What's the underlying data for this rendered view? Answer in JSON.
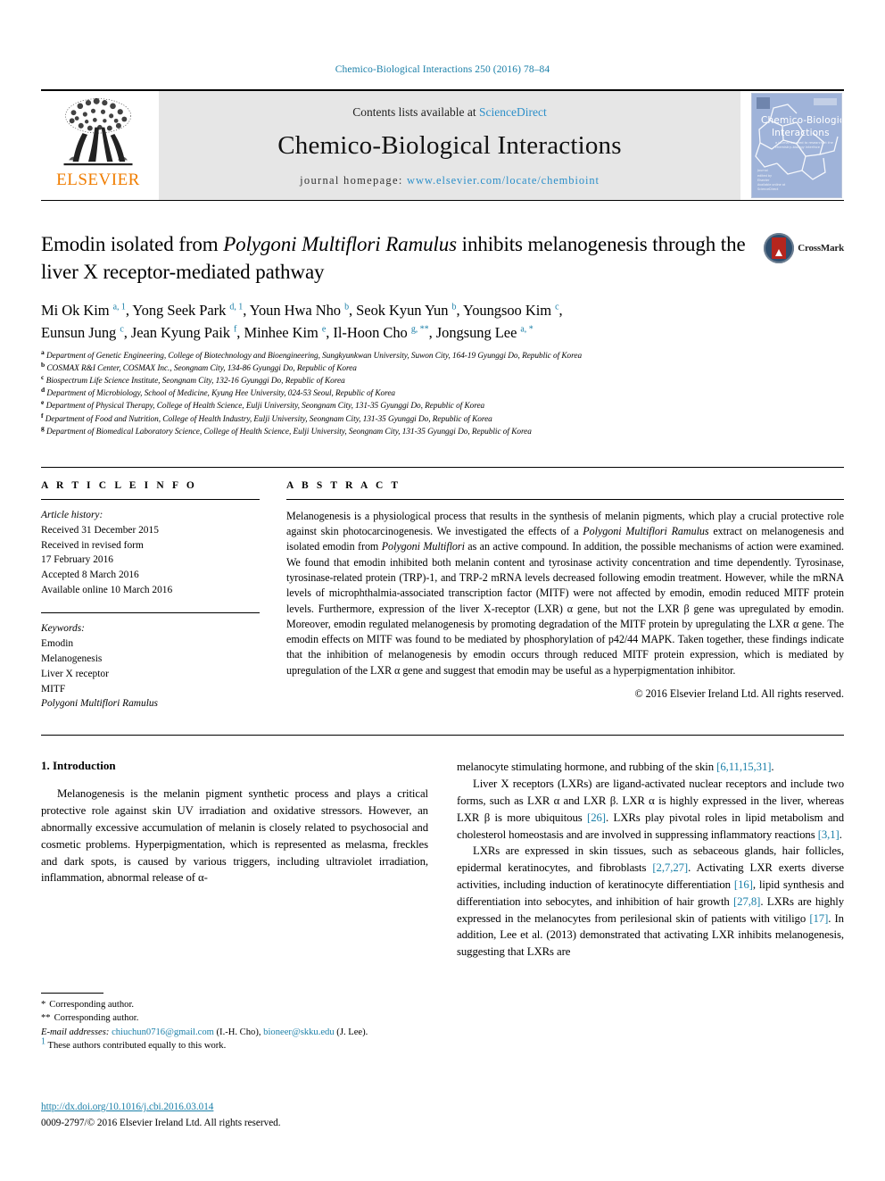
{
  "running_head": "Chemico-Biological Interactions 250 (2016) 78–84",
  "masthead": {
    "elsevier_wordmark": "ELSEVIER",
    "contents_prefix": "Contents lists available at ",
    "sciencedirect": "ScienceDirect",
    "journal_title": "Chemico-Biological Interactions",
    "homepage_prefix": "journal homepage: ",
    "homepage_url": "www.elsevier.com/locate/chembioint",
    "cover": {
      "line1": "Chemico-Biological",
      "line2": "Interactions",
      "subtitle": "a journal devoted to research at the chemistry–biology interface"
    }
  },
  "article": {
    "title_part1": "Emodin isolated from ",
    "title_italic": "Polygoni Multiflori Ramulus",
    "title_part2": " inhibits melanogenesis through the liver X receptor-mediated pathway",
    "crossmark_label": "CrossMark",
    "authors_line1": "Mi Ok Kim a, 1, Yong Seek Park d, 1, Youn Hwa Nho b, Seok Kyun Yun b, Youngsoo Kim c,",
    "authors_line2": "Eunsun Jung c, Jean Kyung Paik f, Minhee Kim e, Il-Hoon Cho g, **, Jongsung Lee a, *",
    "affiliations": [
      {
        "mark": "a",
        "text": "Department of Genetic Engineering, College of Biotechnology and Bioengineering, Sungkyunkwan University, Suwon City, 164-19 Gyunggi Do, Republic of Korea"
      },
      {
        "mark": "b",
        "text": "COSMAX R&I Center, COSMAX Inc., Seongnam City, 134-86 Gyunggi Do, Republic of Korea"
      },
      {
        "mark": "c",
        "text": "Biospectrum Life Science Institute, Seongnam City, 132-16 Gyunggi Do, Republic of Korea"
      },
      {
        "mark": "d",
        "text": "Department of Microbiology, School of Medicine, Kyung Hee University, 024-53 Seoul, Republic of Korea"
      },
      {
        "mark": "e",
        "text": "Department of Physical Therapy, College of Health Science, Eulji University, Seongnam City, 131-35 Gyunggi Do, Republic of Korea"
      },
      {
        "mark": "f",
        "text": "Department of Food and Nutrition, College of Health Industry, Eulji University, Seongnam City, 131-35 Gyunggi Do, Republic of Korea"
      },
      {
        "mark": "g",
        "text": "Department of Biomedical Laboratory Science, College of Health Science, Eulji University, Seongnam City, 131-35 Gyunggi Do, Republic of Korea"
      }
    ]
  },
  "article_info": {
    "label": "A R T I C L E   I N F O",
    "history_heading": "Article history:",
    "history": [
      "Received 31 December 2015",
      "Received in revised form",
      "17 February 2016",
      "Accepted 8 March 2016",
      "Available online 10 March 2016"
    ],
    "keywords_heading": "Keywords:",
    "keywords": [
      "Emodin",
      "Melanogenesis",
      "Liver X receptor",
      "MITF"
    ],
    "keyword_italic": "Polygoni Multiflori Ramulus"
  },
  "abstract": {
    "label": "A B S T R A C T",
    "p1": "Melanogenesis is a physiological process that results in the synthesis of melanin pigments, which play a crucial protective role against skin photocarcinogenesis. We investigated the effects of a ",
    "i1": "Polygoni Multiflori Ramulus",
    "p2": " extract on melanogenesis and isolated emodin from ",
    "i2": "Polygoni Multiflori",
    "p3": " as an active compound. In addition, the possible mechanisms of action were examined. We found that emodin inhibited both melanin content and tyrosinase activity concentration and time dependently. Tyrosinase, tyrosinase-related protein (TRP)-1, and TRP-2 mRNA levels decreased following emodin treatment. However, while the mRNA levels of microphthalmia-associated transcription factor (MITF) were not affected by emodin, emodin reduced MITF protein levels. Furthermore, expression of the liver X-receptor (LXR) α gene, but not the LXR β gene was upregulated by emodin. Moreover, emodin regulated melanogenesis by promoting degradation of the MITF protein by upregulating the LXR α gene. The emodin effects on MITF was found to be mediated by phosphorylation of p42/44 MAPK. Taken together, these findings indicate that the inhibition of melanogenesis by emodin occurs through reduced MITF protein expression, which is mediated by upregulation of the LXR α gene and suggest that emodin may be useful as a hyperpigmentation inhibitor.",
    "copyright": "© 2016 Elsevier Ireland Ltd. All rights reserved."
  },
  "body": {
    "section_heading": "1. Introduction",
    "left_p1": "Melanogenesis is the melanin pigment synthetic process and plays a critical protective role against skin UV irradiation and oxidative stressors. However, an abnormally excessive accumulation of melanin is closely related to psychosocial and cosmetic problems. Hyperpigmentation, which is represented as melasma, freckles and dark spots, is caused by various triggers, including ultraviolet irradiation, inflammation, abnormal release of α-",
    "right_p1_text": "melanocyte stimulating hormone, and rubbing of the skin ",
    "right_p1_ref": "[6,11,15,31]",
    "right_p1_end": ".",
    "right_p2_a": "Liver X receptors (LXRs) are ligand-activated nuclear receptors and include two forms, such as LXR α and LXR β. LXR α is highly expressed in the liver, whereas LXR β is more ubiquitous ",
    "right_p2_r1": "[26]",
    "right_p2_b": ". LXRs play pivotal roles in lipid metabolism and cholesterol homeostasis and are involved in suppressing inflammatory reactions ",
    "right_p2_r2": "[3,1]",
    "right_p2_c": ".",
    "right_p3_a": "LXRs are expressed in skin tissues, such as sebaceous glands, hair follicles, epidermal keratinocytes, and fibroblasts ",
    "right_p3_r1": "[2,7,27]",
    "right_p3_b": ". Activating LXR exerts diverse activities, including induction of keratinocyte differentiation ",
    "right_p3_r2": "[16]",
    "right_p3_c": ", lipid synthesis and differentiation into sebocytes, and inhibition of hair growth ",
    "right_p3_r3": "[27,8]",
    "right_p3_d": ". LXRs are highly expressed in the melanocytes from perilesional skin of patients with vitiligo ",
    "right_p3_r4": "[17]",
    "right_p3_e": ". In addition, Lee et al. (2013) demonstrated that activating LXR inhibits melanogenesis, suggesting that LXRs are"
  },
  "footnotes": {
    "corresponding_1_mark": "*",
    "corresponding_1": "Corresponding author.",
    "corresponding_2_mark": "**",
    "corresponding_2": "Corresponding author.",
    "email_label": "E-mail addresses:",
    "email_1": "chiuchun0716@gmail.com",
    "email_1_owner": " (I.-H. Cho), ",
    "email_2": "bioneer@skku.edu",
    "email_2_owner": " (J. Lee).",
    "equal_mark": "1",
    "equal_contribution": "These authors contributed equally to this work.",
    "doi": "http://dx.doi.org/10.1016/j.cbi.2016.03.014",
    "issn": "0009-2797/© 2016 Elsevier Ireland Ltd. All rights reserved."
  },
  "colors": {
    "link": "#1a7fa8",
    "sciencedirect": "#2c8fc9",
    "elsevier_orange": "#f07d00",
    "band_gray": "#e6e6e6"
  }
}
